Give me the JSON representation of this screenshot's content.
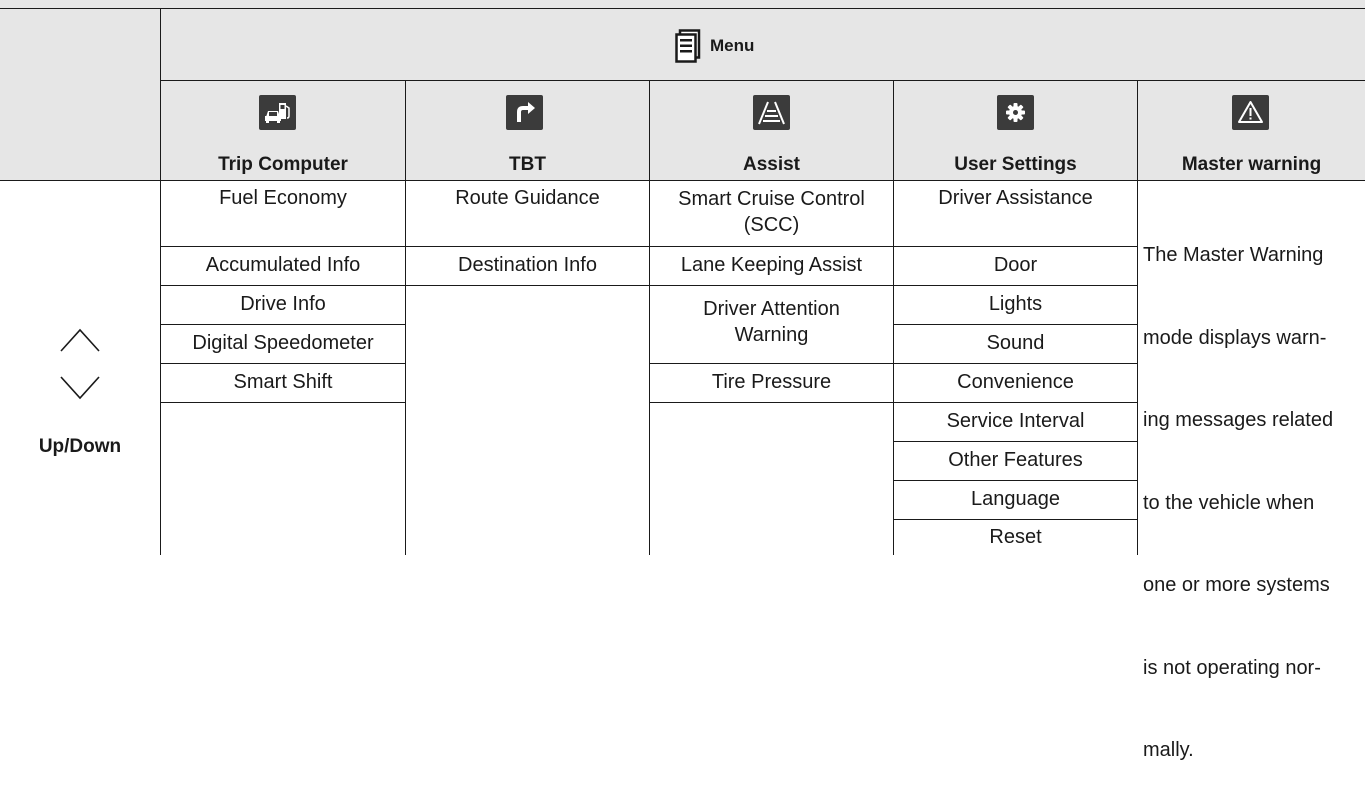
{
  "menu": {
    "title": "Menu",
    "icon": "menu-document-icon"
  },
  "columns": [
    {
      "title": "Trip Computer",
      "icon": "car-fuel-icon",
      "items": [
        "Fuel Economy",
        "Accumulated Info",
        "Drive Info",
        "Digital Speedometer",
        "Smart Shift"
      ]
    },
    {
      "title": "TBT",
      "icon": "turn-right-arrow-icon",
      "items": [
        "Route Guidance",
        "Destination Info"
      ]
    },
    {
      "title": "Assist",
      "icon": "lane-road-icon",
      "items": [
        {
          "line1": "Smart Cruise Control",
          "line2": "(SCC)"
        },
        "Lane Keeping Assist",
        {
          "line1": "Driver Attention",
          "line2": "Warning"
        },
        "Tire Pressure"
      ]
    },
    {
      "title": "User Settings",
      "icon": "gear-icon",
      "items": [
        "Driver Assistance",
        "Door",
        "Lights",
        "Sound",
        "Convenience",
        "Service Interval",
        "Other Features",
        "Language",
        "Reset"
      ]
    },
    {
      "title": "Master warning",
      "icon": "warning-triangle-icon",
      "lines": [
        "The Master Warning",
        "mode displays warn-",
        "ing messages related",
        "to the vehicle when",
        "one or more systems",
        "is not operating nor-",
        "mally."
      ]
    }
  ],
  "navigation": {
    "label": "Up/Down",
    "up_icon": "chevron-up-icon",
    "down_icon": "chevron-down-icon"
  },
  "colors": {
    "header_background": "#e6e6e6",
    "icon_background": "#3b3b3b",
    "line": "#1a1a1a"
  }
}
